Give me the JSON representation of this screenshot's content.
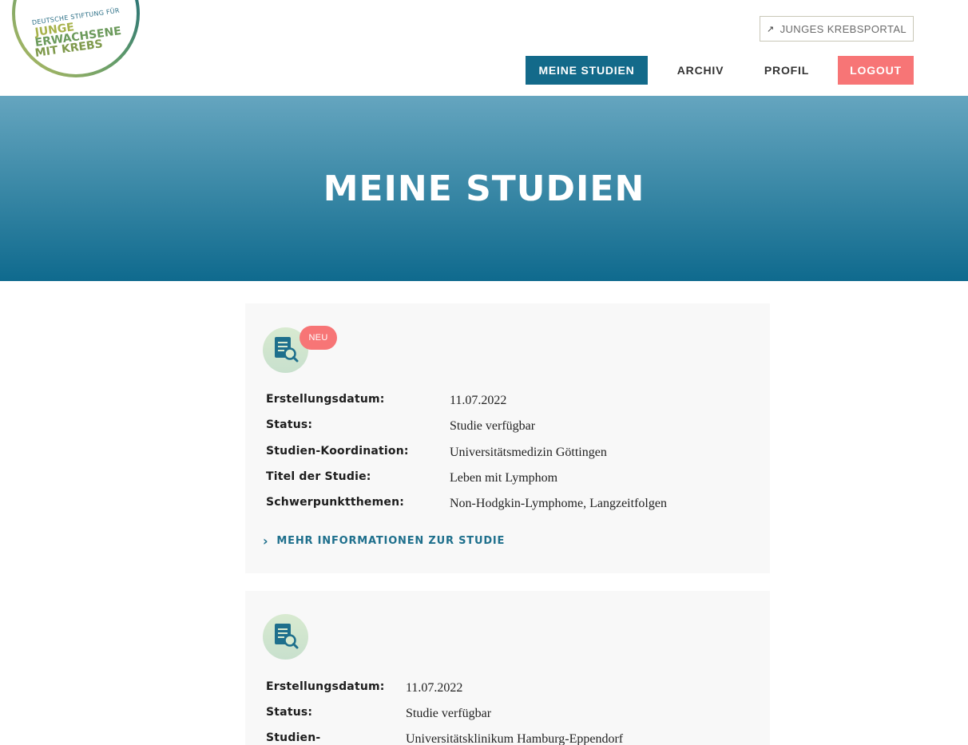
{
  "logo": {
    "line_small": "DEUTSCHE STIFTUNG FÜR",
    "line1": "JUNGE",
    "line2": "ERWACHSENE",
    "line3": "MIT KREBS"
  },
  "header": {
    "portal_link": "JUNGES KREBSPORTAL",
    "nav": {
      "meine_studien": "MEINE STUDIEN",
      "archiv": "ARCHIV",
      "profil": "PROFIL",
      "logout": "LOGOUT"
    }
  },
  "hero": {
    "title": "MEINE STUDIEN"
  },
  "colors": {
    "primary": "#136a8a",
    "accent": "#f77576",
    "card_bg": "#f8f8f8"
  },
  "studies": [
    {
      "badge": "NEU",
      "icon": "study-document-search-icon",
      "fields": [
        {
          "label": "Erstellungsdatum:",
          "value": "11.07.2022"
        },
        {
          "label": "Status:",
          "value": "Studie verfügbar"
        },
        {
          "label": "Studien-Koordination:",
          "value": "Universitätsmedizin Göttingen"
        },
        {
          "label": "Titel der Studie:",
          "value": "Leben mit Lymphom"
        },
        {
          "label": "Schwerpunktthemen:",
          "value": "Non-Hodgkin-Lymphome, Langzeitfolgen"
        }
      ],
      "more_link": "MEHR INFORMATIONEN ZUR STUDIE"
    },
    {
      "icon": "study-document-search-icon",
      "fields": [
        {
          "label": "Erstellungsdatum:",
          "value": "11.07.2022"
        },
        {
          "label": "Status:",
          "value": "Studie verfügbar"
        },
        {
          "label": "Studien-",
          "value": "Universitätsklinikum Hamburg-Eppendorf"
        }
      ]
    }
  ]
}
